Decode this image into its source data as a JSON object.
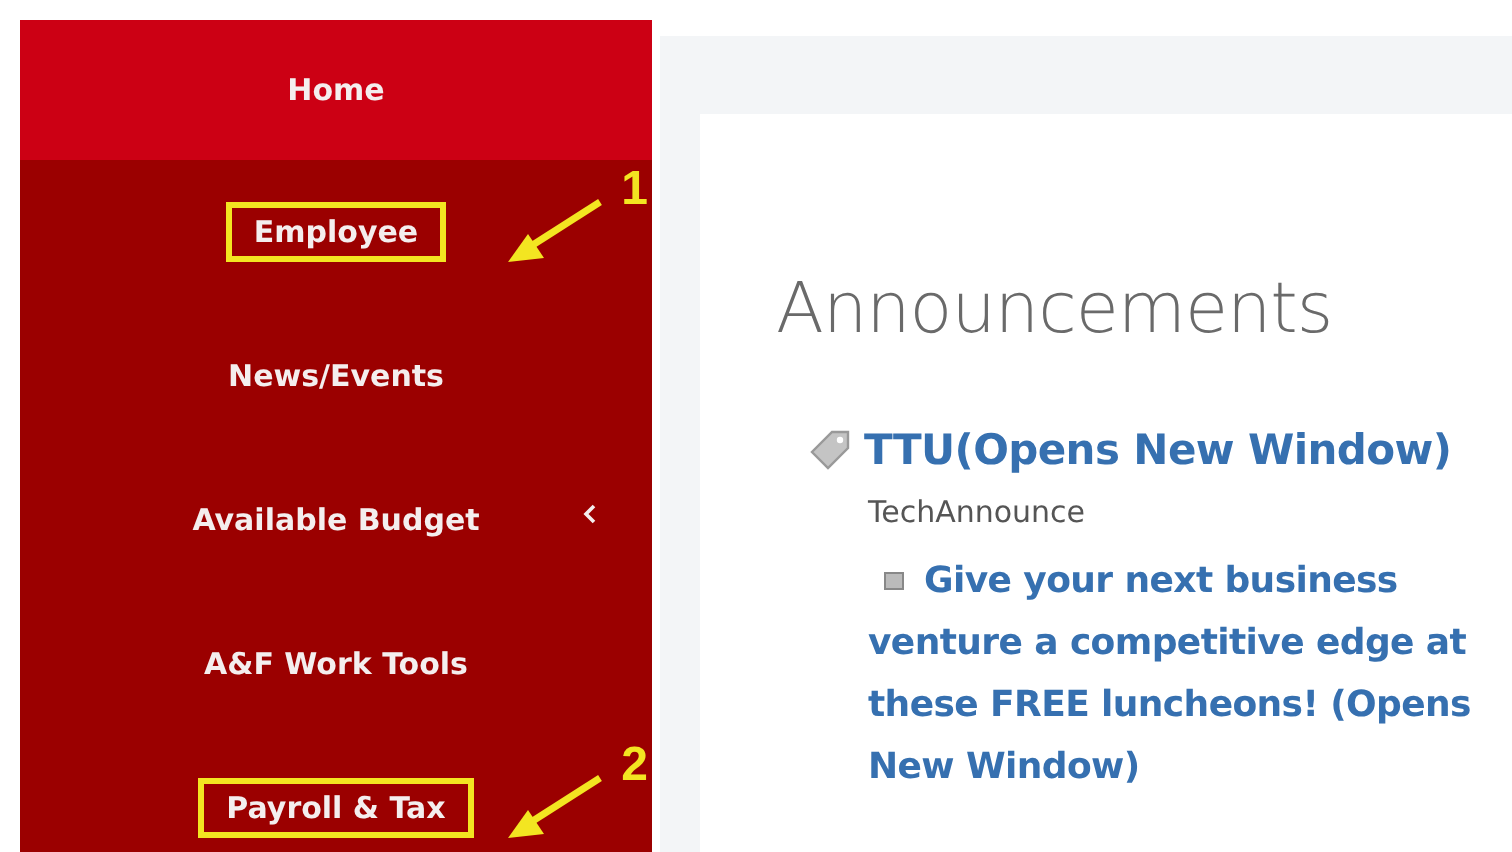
{
  "sidebar": {
    "items": [
      {
        "label": "Home",
        "selected": true,
        "expandable": false,
        "highlighted": false
      },
      {
        "label": "Employee",
        "selected": false,
        "expandable": false,
        "highlighted": true,
        "callout": "1"
      },
      {
        "label": "News/Events",
        "selected": false,
        "expandable": false,
        "highlighted": false
      },
      {
        "label": "Available Budget",
        "selected": false,
        "expandable": true,
        "highlighted": false
      },
      {
        "label": "A&F Work Tools",
        "selected": false,
        "expandable": false,
        "highlighted": false
      },
      {
        "label": "Payroll & Tax",
        "selected": false,
        "expandable": false,
        "highlighted": true,
        "callout": "2"
      }
    ]
  },
  "content": {
    "heading": "Announcements",
    "feed": {
      "title": "TTU(Opens New Window)",
      "source": "TechAnnounce",
      "items": [
        {
          "lines": [
            "Give your next business",
            "venture a competitive edge at",
            "these FREE luncheons! (Opens",
            "New Window)"
          ]
        }
      ]
    }
  }
}
